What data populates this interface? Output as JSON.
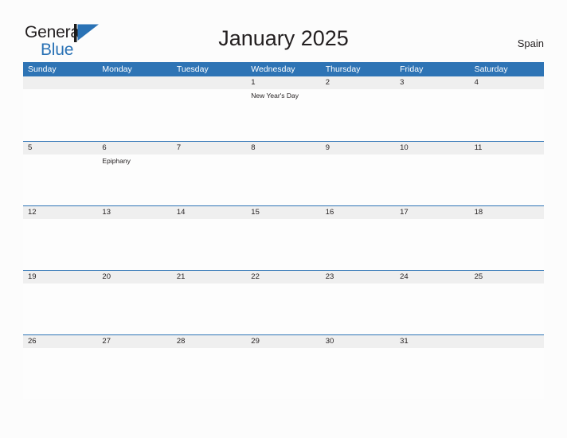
{
  "brand": {
    "name_part1": "General",
    "name_part2": "Blue",
    "flag_icon": "blue-flag-triangle-icon",
    "primary_color": "#2a72b5"
  },
  "header": {
    "title": "January 2025",
    "locale": "Spain"
  },
  "calendar": {
    "month": "January",
    "year": "2025",
    "accent_color": "#2e74b5",
    "date_strip_color": "#efefef",
    "weekdays": [
      "Sunday",
      "Monday",
      "Tuesday",
      "Wednesday",
      "Thursday",
      "Friday",
      "Saturday"
    ],
    "weeks": [
      {
        "dates": [
          "",
          "",
          "",
          "1",
          "2",
          "3",
          "4"
        ],
        "events": [
          "",
          "",
          "",
          "New Year's Day",
          "",
          "",
          ""
        ]
      },
      {
        "dates": [
          "5",
          "6",
          "7",
          "8",
          "9",
          "10",
          "11"
        ],
        "events": [
          "",
          "Epiphany",
          "",
          "",
          "",
          "",
          ""
        ]
      },
      {
        "dates": [
          "12",
          "13",
          "14",
          "15",
          "16",
          "17",
          "18"
        ],
        "events": [
          "",
          "",
          "",
          "",
          "",
          "",
          ""
        ]
      },
      {
        "dates": [
          "19",
          "20",
          "21",
          "22",
          "23",
          "24",
          "25"
        ],
        "events": [
          "",
          "",
          "",
          "",
          "",
          "",
          ""
        ]
      },
      {
        "dates": [
          "26",
          "27",
          "28",
          "29",
          "30",
          "31",
          ""
        ],
        "events": [
          "",
          "",
          "",
          "",
          "",
          "",
          ""
        ]
      }
    ]
  }
}
